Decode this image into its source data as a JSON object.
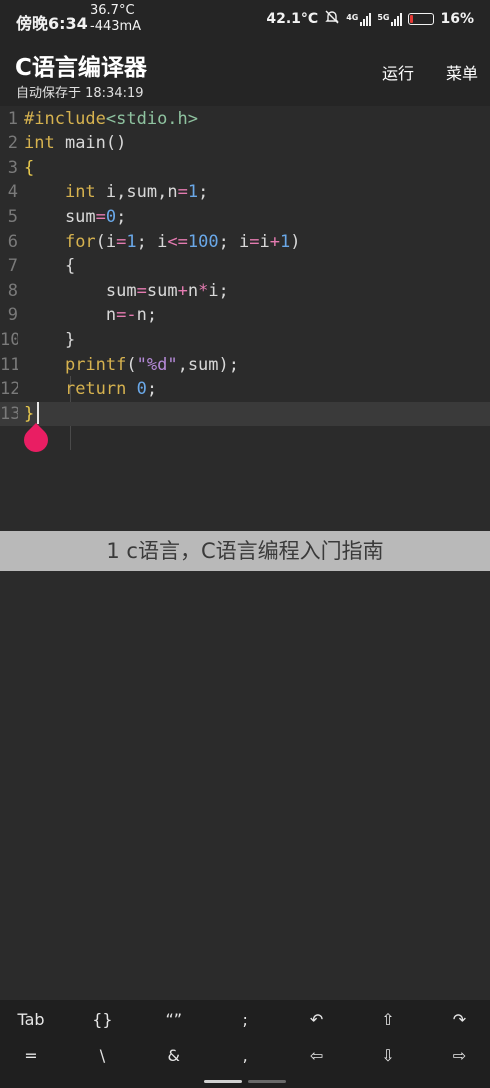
{
  "status_bar": {
    "time": "傍晚6:34",
    "temp_line1": "36.7°C",
    "temp_line2": "-443mA",
    "cpu_temp": "42.1°C",
    "signal1_label": "4G",
    "signal2_label": "5G",
    "battery_percent": "16%",
    "battery_level": 0.16,
    "battery_color": "#e53935"
  },
  "header": {
    "title": "C语言编译器",
    "subtitle": "自动保存于 18:34:19",
    "run_label": "运行",
    "menu_label": "菜单"
  },
  "editor": {
    "colors": {
      "default": "#d8d8d8",
      "keyword": "#d6b24f",
      "number": "#6aa8e8",
      "operator": "#e57bb1",
      "string": "#b58ad8",
      "include_tag": "#8fc3a0",
      "brace": "#e8c94d"
    },
    "current_line": 13,
    "lines": [
      {
        "num": "1",
        "tokens": [
          [
            "#include",
            "keyword"
          ],
          [
            "<stdio.h>",
            "include_tag"
          ]
        ]
      },
      {
        "num": "2",
        "tokens": [
          [
            "int",
            "keyword"
          ],
          [
            " main()",
            "default"
          ]
        ]
      },
      {
        "num": "3",
        "tokens": [
          [
            "{",
            "brace"
          ]
        ]
      },
      {
        "num": "4",
        "tokens": [
          [
            "    ",
            "default"
          ],
          [
            "int",
            "keyword"
          ],
          [
            " i,sum,n",
            "default"
          ],
          [
            "=",
            "operator"
          ],
          [
            "1",
            "number"
          ],
          [
            ";",
            "default"
          ]
        ]
      },
      {
        "num": "5",
        "tokens": [
          [
            "    sum",
            "default"
          ],
          [
            "=",
            "operator"
          ],
          [
            "0",
            "number"
          ],
          [
            ";",
            "default"
          ]
        ]
      },
      {
        "num": "6",
        "tokens": [
          [
            "    ",
            "default"
          ],
          [
            "for",
            "keyword"
          ],
          [
            "(i",
            "default"
          ],
          [
            "=",
            "operator"
          ],
          [
            "1",
            "number"
          ],
          [
            "; i",
            "default"
          ],
          [
            "<=",
            "operator"
          ],
          [
            "100",
            "number"
          ],
          [
            "; i",
            "default"
          ],
          [
            "=",
            "operator"
          ],
          [
            "i",
            "default"
          ],
          [
            "+",
            "operator"
          ],
          [
            "1",
            "number"
          ],
          [
            ")",
            "default"
          ]
        ]
      },
      {
        "num": "7",
        "tokens": [
          [
            "    {",
            "default"
          ]
        ]
      },
      {
        "num": "8",
        "tokens": [
          [
            "        sum",
            "default"
          ],
          [
            "=",
            "operator"
          ],
          [
            "sum",
            "default"
          ],
          [
            "+",
            "operator"
          ],
          [
            "n",
            "default"
          ],
          [
            "*",
            "operator"
          ],
          [
            "i;",
            "default"
          ]
        ]
      },
      {
        "num": "9",
        "tokens": [
          [
            "        n",
            "default"
          ],
          [
            "=-",
            "operator"
          ],
          [
            "n;",
            "default"
          ]
        ]
      },
      {
        "num": "10",
        "tokens": [
          [
            "    }",
            "default"
          ]
        ]
      },
      {
        "num": "11",
        "tokens": [
          [
            "    ",
            "default"
          ],
          [
            "printf",
            "keyword"
          ],
          [
            "(",
            "default"
          ],
          [
            "\"%d\"",
            "string"
          ],
          [
            ",sum);",
            "default"
          ]
        ]
      },
      {
        "num": "12",
        "tokens": [
          [
            "    ",
            "default"
          ],
          [
            "return",
            "keyword"
          ],
          [
            " ",
            "default"
          ],
          [
            "0",
            "number"
          ],
          [
            ";",
            "default"
          ]
        ]
      },
      {
        "num": "13",
        "tokens": [
          [
            "}",
            "brace"
          ]
        ]
      }
    ]
  },
  "caption": "1 c语言，C语言编程入门指南",
  "keyboard": {
    "row1": [
      "Tab",
      "{}",
      "“”",
      ";",
      "↶",
      "⇧",
      "↷"
    ],
    "row2": [
      "=",
      "\\",
      "&",
      ",",
      "⇦",
      "⇩",
      "⇨"
    ]
  }
}
